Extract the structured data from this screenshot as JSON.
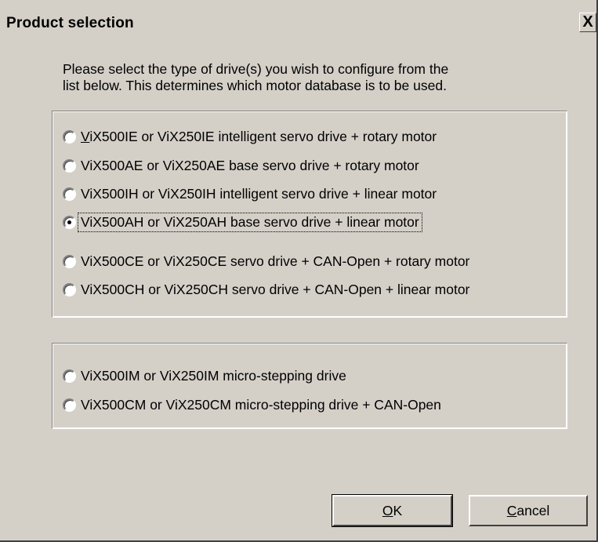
{
  "window": {
    "title": "Product selection",
    "close_label": "X"
  },
  "instructions": {
    "line1": "Please select the type of drive(s) you wish to configure from the",
    "line2": "list below. This determines which motor database is to be used."
  },
  "servo_options": [
    {
      "mnemonic": "V",
      "rest": "iX500IE or ViX250IE intelligent servo drive + rotary motor",
      "selected": false
    },
    {
      "mnemonic": "",
      "rest": "ViX500AE or ViX250AE base servo drive + rotary motor",
      "selected": false
    },
    {
      "mnemonic": "",
      "rest": "ViX500IH or ViX250IH intelligent servo drive + linear motor",
      "selected": false
    },
    {
      "mnemonic": "",
      "rest": "ViX500AH or ViX250AH base servo drive + linear motor",
      "selected": true
    },
    {
      "mnemonic": "",
      "rest": "ViX500CE or ViX250CE servo drive + CAN-Open + rotary motor",
      "selected": false
    },
    {
      "mnemonic": "",
      "rest": "ViX500CH or ViX250CH servo drive + CAN-Open + linear motor",
      "selected": false
    }
  ],
  "stepper_options": [
    {
      "label": "ViX500IM or ViX250IM micro-stepping drive",
      "selected": false
    },
    {
      "label": "ViX500CM or ViX250CM micro-stepping drive + CAN-Open",
      "selected": false
    }
  ],
  "buttons": {
    "ok_mnemonic": "O",
    "ok_rest": "K",
    "cancel_mnemonic": "C",
    "cancel_rest": "ancel"
  }
}
